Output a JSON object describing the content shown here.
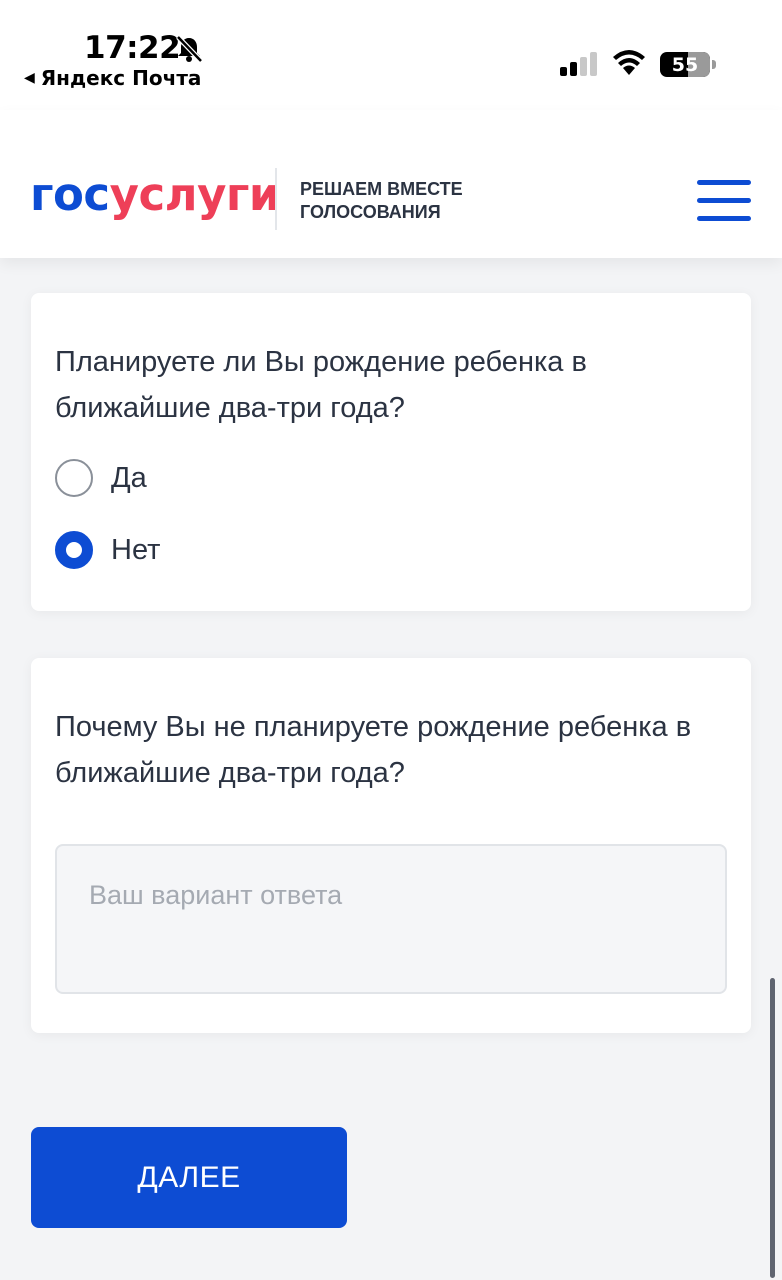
{
  "status_bar": {
    "time": "17:22",
    "back_app": "Яндекс Почта",
    "battery": "55"
  },
  "header": {
    "logo_part1": "гос",
    "logo_part2": "услуги",
    "tagline_line1": "РЕШАЕМ ВМЕСТЕ",
    "tagline_line2": "ГОЛОСОВАНИЯ"
  },
  "question1": {
    "text": "Планируете ли Вы рождение ребенка в ближайшие два-три года?",
    "options": [
      {
        "label": "Да",
        "selected": false
      },
      {
        "label": "Нет",
        "selected": true
      }
    ]
  },
  "question2": {
    "text": "Почему Вы не планируете рождение ребенка в ближайшие два-три года?",
    "placeholder": "Ваш вариант ответа",
    "value": ""
  },
  "next_button": {
    "label": "ДАЛЕЕ"
  },
  "colors": {
    "brand_blue": "#0d4cd3",
    "brand_red": "#ee3f58"
  }
}
